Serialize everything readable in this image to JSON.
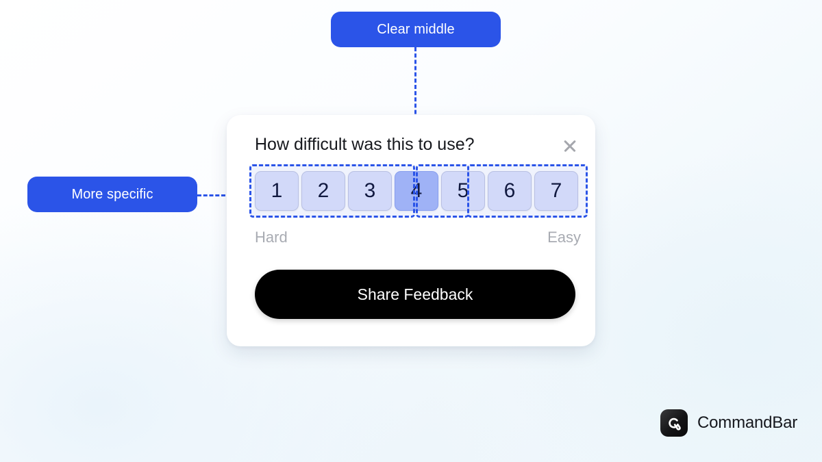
{
  "annotations": {
    "clear_middle": {
      "label": "Clear middle",
      "color": "#2b54e8"
    },
    "more_specific": {
      "label": "More specific",
      "color": "#2b54e8"
    }
  },
  "survey_card": {
    "title": "How difficult was this to use?",
    "close_icon": "close-icon",
    "rating": {
      "options": [
        "1",
        "2",
        "3",
        "4",
        "5",
        "6",
        "7"
      ],
      "selected": "4",
      "low_label": "Hard",
      "high_label": "Easy",
      "unselected_color": "#dfe4fb",
      "selected_color": "#a8baf8"
    },
    "submit_label": "Share Feedback",
    "submit_color": "#000000"
  },
  "brand": {
    "name": "CommandBar",
    "mark_icon": "commandbar-logo-icon"
  }
}
